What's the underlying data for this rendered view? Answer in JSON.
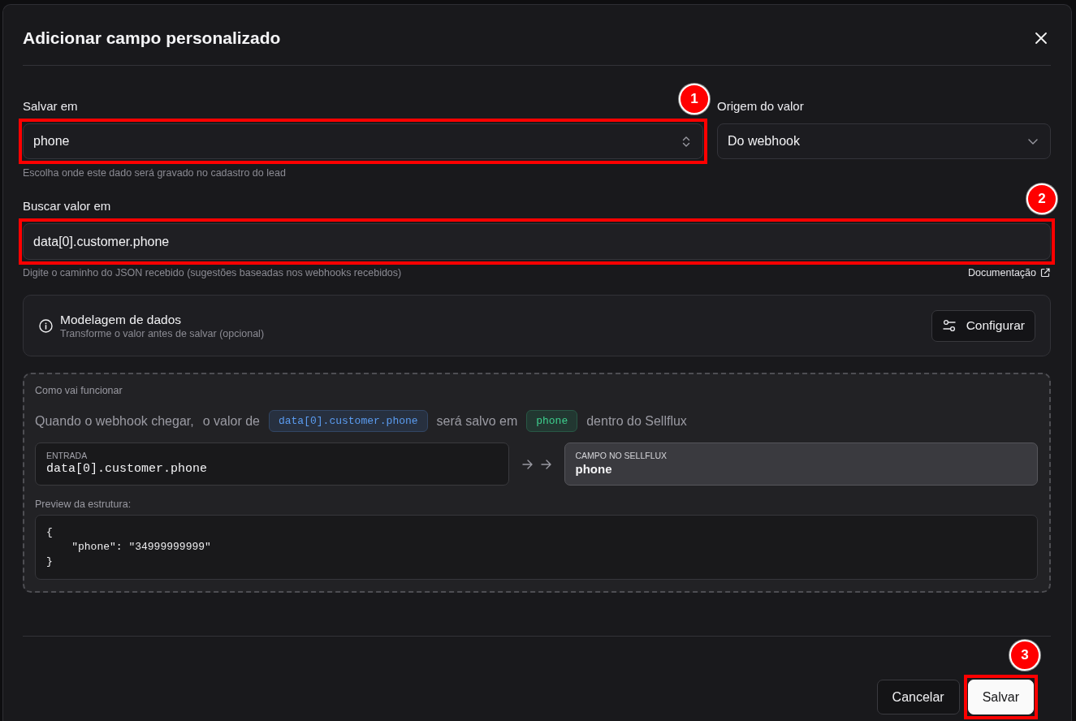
{
  "dialog": {
    "title": "Adicionar campo personalizado"
  },
  "save_to": {
    "label": "Salvar em",
    "value": "phone",
    "hint": "Escolha onde este dado será gravado no cadastro do lead",
    "annotation": "1"
  },
  "value_origin": {
    "label": "Origem do valor",
    "value": "Do webhook"
  },
  "fetch_from": {
    "label": "Buscar valor em",
    "value": "data[0].customer.phone",
    "hint": "Digite o caminho do JSON recebido (sugestões baseadas nos webhooks recebidos)",
    "link": "Documentação",
    "annotation": "2"
  },
  "data_modeling": {
    "title": "Modelagem de dados",
    "subtitle": "Transforme o valor antes de salvar (opcional)",
    "button": "Configurar"
  },
  "how_it_works": {
    "title": "Como vai funcionar",
    "sentence": [
      {
        "kind": "text",
        "text": "Quando o webhook chegar,"
      },
      {
        "kind": "text",
        "text": "o valor de"
      },
      {
        "kind": "chip",
        "text": "data[0].customer.phone",
        "color": "#5b9cf0"
      },
      {
        "kind": "text",
        "text": "será salvo em"
      },
      {
        "kind": "chip",
        "text": "phone",
        "color": "#3ecf8e"
      },
      {
        "kind": "text",
        "text": "dentro do Sellflux"
      }
    ],
    "mapping": [
      {
        "kind": "source",
        "label": "ENTRADA",
        "value": "data[0].customer.phone"
      },
      {
        "kind": "target",
        "label": "CAMPO NO SELLFLUX",
        "value": "phone"
      }
    ],
    "preview_label": "Preview da estrutura:",
    "preview_code": "{\n    \"phone\": \"34999999999\"\n}"
  },
  "footer": {
    "buttons": [
      {
        "kind": "secondary",
        "label": "Cancelar"
      },
      {
        "kind": "primary",
        "label": "Salvar",
        "annotation": "3"
      }
    ]
  }
}
